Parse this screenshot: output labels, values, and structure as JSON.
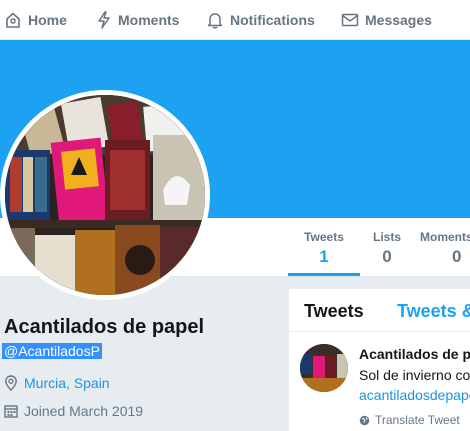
{
  "nav": {
    "items": [
      {
        "label": "Home",
        "icon": "home-icon"
      },
      {
        "label": "Moments",
        "icon": "lightning-icon"
      },
      {
        "label": "Notifications",
        "icon": "bell-icon"
      },
      {
        "label": "Messages",
        "icon": "envelope-icon"
      }
    ]
  },
  "colors": {
    "accent": "#1da1f2",
    "link": "#1b95e0",
    "banner": "#1da1f2",
    "background": "#e6ecf0",
    "selection": "#3390ff"
  },
  "stats": [
    {
      "label": "Tweets",
      "value": "1",
      "active": true
    },
    {
      "label": "Lists",
      "value": "0"
    },
    {
      "label": "Moments",
      "value": "0"
    }
  ],
  "profile": {
    "name": "Acantilados de papel",
    "handle": "@AcantiladosP",
    "location": "Murcia, Spain",
    "joined": "Joined March 2019"
  },
  "timeline": {
    "tabs": [
      "Tweets",
      "Tweets & replies"
    ],
    "tweet": {
      "author": "Acantilados de papel",
      "text": "Sol de invierno con",
      "link": "acantiladosdepapel",
      "translate_label": "Translate Tweet"
    }
  }
}
